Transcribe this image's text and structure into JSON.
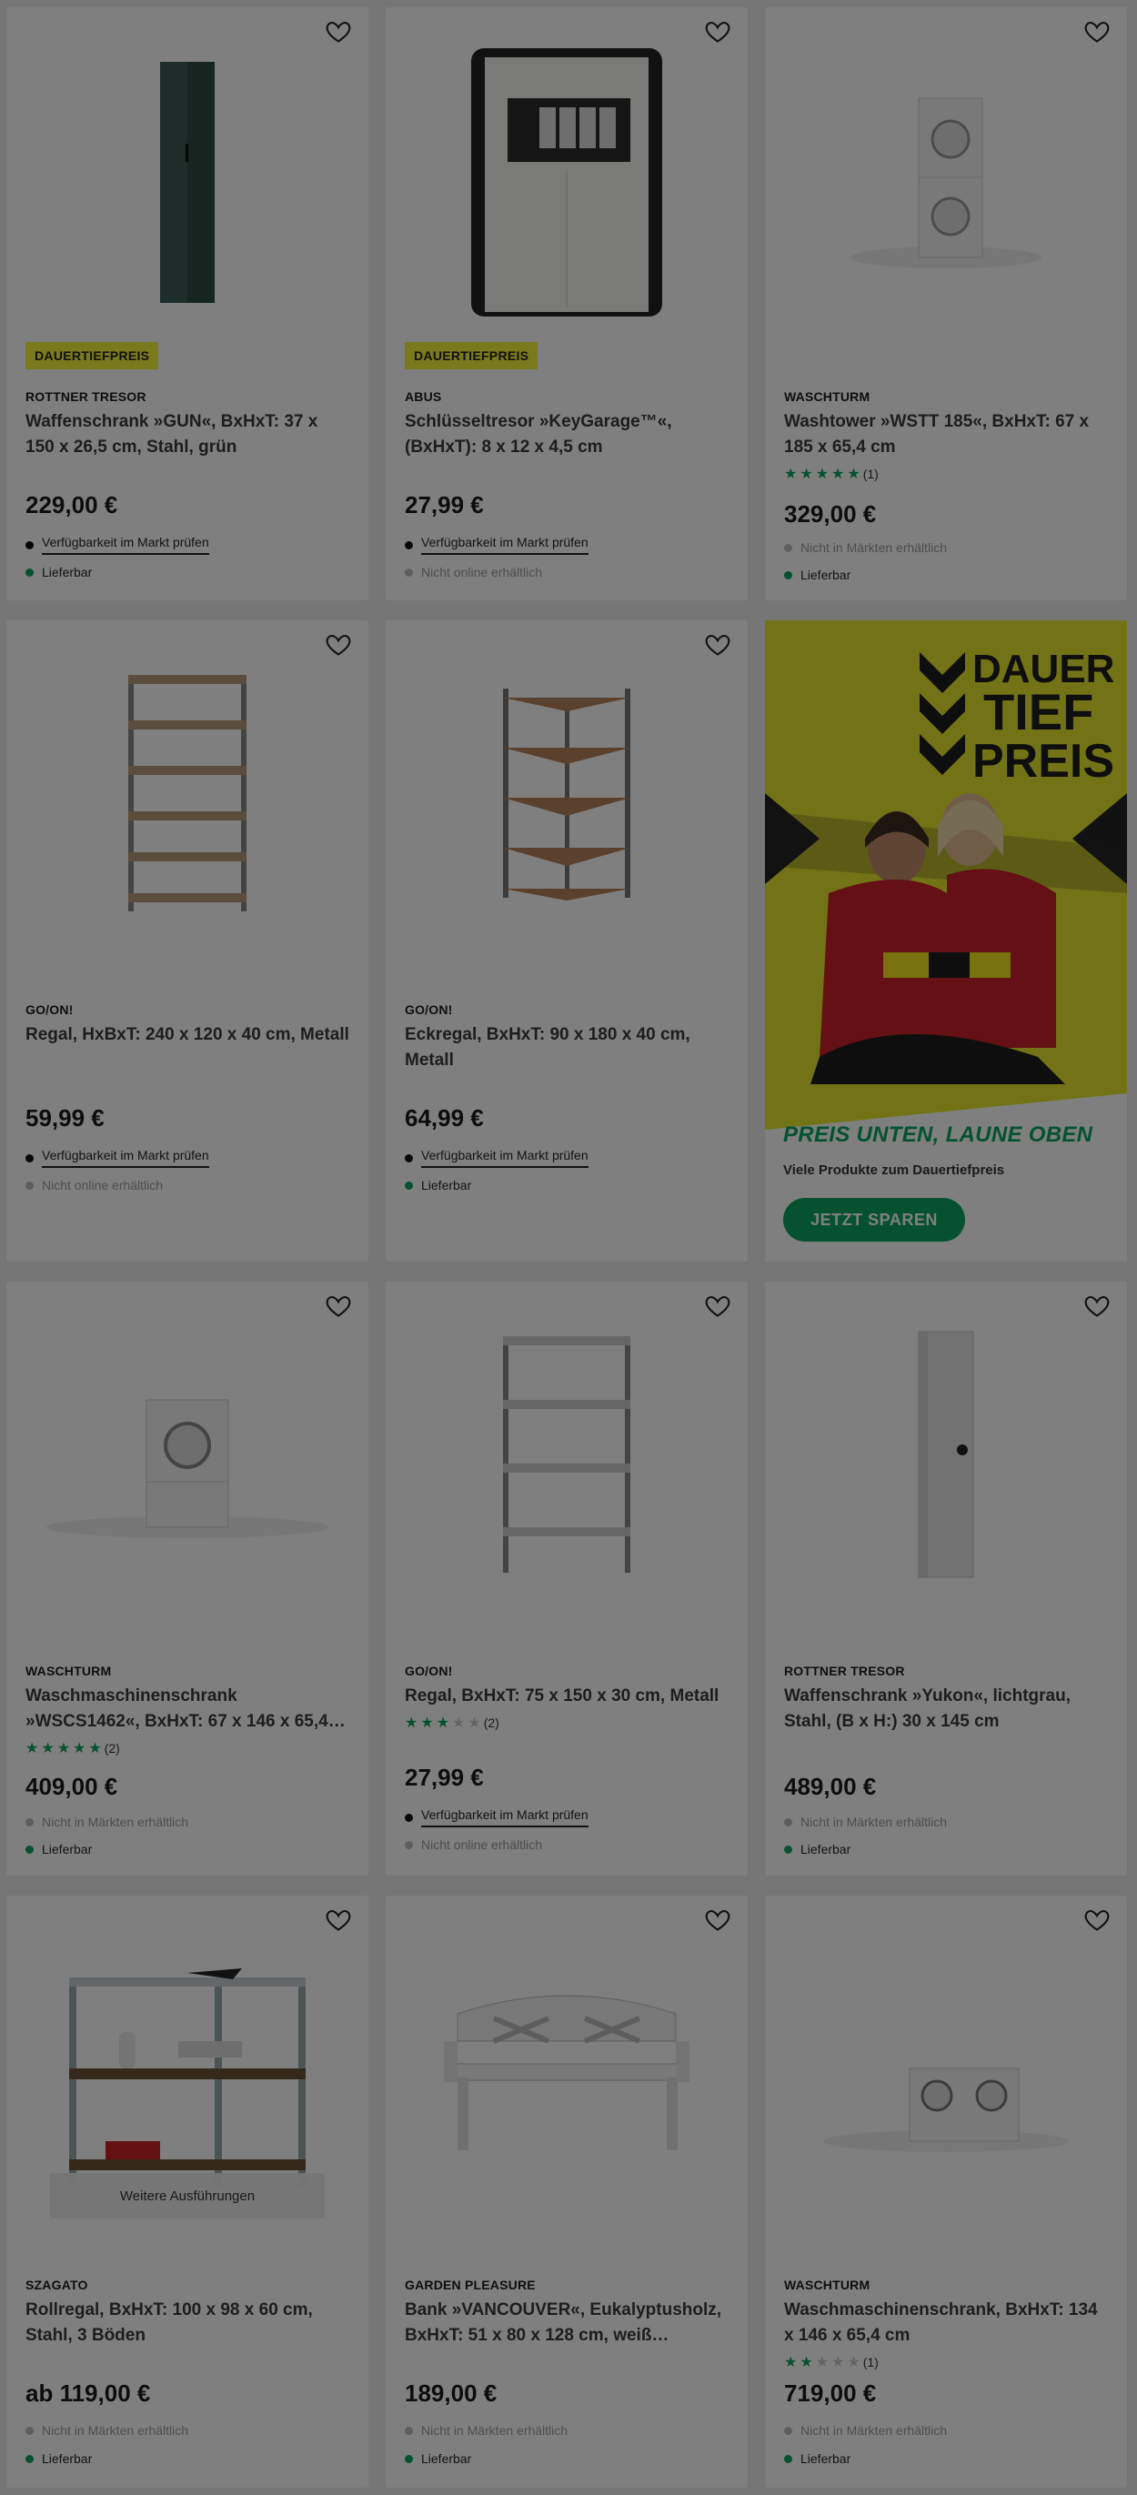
{
  "ui": {
    "badge_label": "DAUERTIEFPREIS",
    "more_variants_label": "Weitere Ausführungen",
    "check_market_label": "Verfügbarkeit im Markt prüfen",
    "not_online_label": "Nicht online erhältlich",
    "not_in_markets_label": "Nicht in Märkten erhältlich",
    "deliverable_label": "Lieferbar"
  },
  "products": [
    {
      "brand": "ROTTNER TRESOR",
      "title_l1": "Waffenschrank »GUN«, BxHxT: 37 x",
      "title_l2": "150 x 26,5 cm, Stahl, grün",
      "price": "229,00 €",
      "badge": true,
      "rating": null
    },
    {
      "brand": "ABUS",
      "title_l1": "Schlüsseltresor »KeyGarage™«,",
      "title_l2": "(BxHxT): 8 x 12 x 4,5 cm",
      "price": "27,99 €",
      "badge": true,
      "rating": null
    },
    {
      "brand": "WASCHTURM",
      "title_l1": "Washtower »WSTT 185«, BxHxT: 67 x",
      "title_l2": "185 x 65,4 cm",
      "price": "329,00 €",
      "badge": false,
      "rating": {
        "stars": 5,
        "count": "(1)"
      }
    },
    {
      "brand": "GO/ON!",
      "title_l1": "Regal, HxBxT: 240 x 120 x 40 cm, Metall",
      "title_l2": "",
      "price": "59,99 €",
      "badge": false,
      "rating": null
    },
    {
      "brand": "GO/ON!",
      "title_l1": "Eckregal, BxHxT: 90 x 180 x 40 cm,",
      "title_l2": "Metall",
      "price": "64,99 €",
      "badge": false,
      "rating": null
    },
    {
      "brand": "WASCHTURM",
      "title_l1": "Waschmaschinenschrank",
      "title_l2": "»WSCS1462«, BxHxT: 67 x 146 x 65,4…",
      "price": "409,00 €",
      "badge": false,
      "rating": {
        "stars": 5,
        "count": "(2)"
      }
    },
    {
      "brand": "GO/ON!",
      "title_l1": "Regal, BxHxT: 75 x 150 x 30 cm, Metall",
      "title_l2": "",
      "price": "27,99 €",
      "badge": false,
      "rating": {
        "stars": 3,
        "count": "(2)"
      }
    },
    {
      "brand": "ROTTNER TRESOR",
      "title_l1": "Waffenschrank »Yukon«, lichtgrau,",
      "title_l2": "Stahl, (B x H:) 30 x 145 cm",
      "price": "489,00 €",
      "badge": false,
      "rating": null
    },
    {
      "brand": "SZAGATO",
      "title_l1": "Rollregal, BxHxT: 100 x 98 x 60 cm,",
      "title_l2": "Stahl, 3 Böden",
      "price": "ab 119,00 €",
      "badge": false,
      "rating": null
    },
    {
      "brand": "GARDEN PLEASURE",
      "title_l1": "Bank »VANCOUVER«, Eukalyptusholz,",
      "title_l2": "BxHxT: 51 x 80 x 128 cm, weiß…",
      "price": "189,00 €",
      "badge": false,
      "rating": null
    },
    {
      "brand": "WASCHTURM",
      "title_l1": "Waschmaschinenschrank, BxHxT: 134",
      "title_l2": "x 146 x 65,4 cm",
      "price": "719,00 €",
      "badge": false,
      "rating": {
        "stars": 2,
        "count": "(1)"
      }
    }
  ],
  "promo": {
    "headline_l1": "DAUER",
    "headline_l2": "TIEF",
    "headline_l3": "PREIS",
    "slogan": "PREIS UNTEN, LAUNE OBEN",
    "subline": "Viele Produkte zum Dauertiefpreis",
    "cta": "JETZT SPAREN"
  },
  "colors": {
    "accent_green": "#0aa360",
    "badge_yellow": "#f2f23a",
    "promo_bg": "#e4e62c"
  }
}
